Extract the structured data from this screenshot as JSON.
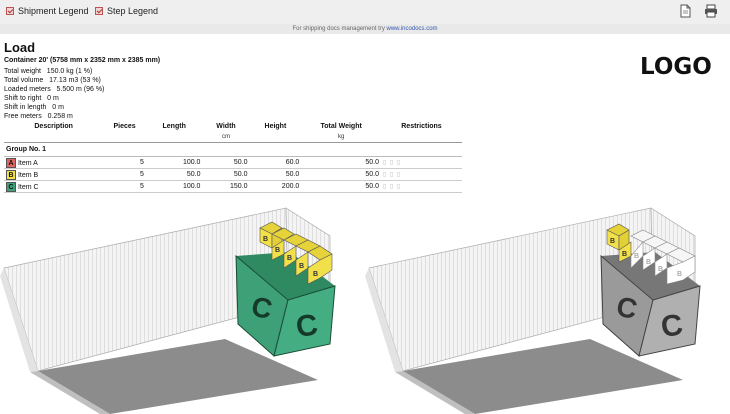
{
  "toolbar": {
    "shipment_legend": "Shipment Legend",
    "step_legend": "Step Legend",
    "icons": [
      "document-icon",
      "printer-icon"
    ]
  },
  "subbar": {
    "prefix": "For shipping docs management try",
    "link": "www.incodocs.com"
  },
  "header": {
    "title": "Load",
    "container": "Container 20' (5758 mm x 2352 mm x 2385 mm)",
    "logo": "LOGO"
  },
  "stats": [
    "Total weight   150.0 kg (1 %)",
    "Total volume   17.13 m3 (53 %)",
    "Loaded meters   5.500 m (96 %)",
    "Shift to right   0 m",
    "Shift in length   0 m",
    "Free meters   0.258 m"
  ],
  "table": {
    "headers": [
      "Description",
      "Pieces",
      "Length",
      "Width",
      "Height",
      "Total Weight",
      "Restrictions"
    ],
    "units": [
      "",
      "",
      "",
      "cm",
      "",
      "kg",
      ""
    ],
    "group": "Group No. 1",
    "rows": [
      {
        "badge": "A",
        "color": "#e06666",
        "name": "Item A",
        "pieces": "5",
        "length": "100.0",
        "width": "50.0",
        "height": "60.0",
        "weight": "50.0"
      },
      {
        "badge": "B",
        "color": "#f2e04a",
        "name": "Item B",
        "pieces": "5",
        "length": "50.0",
        "width": "50.0",
        "height": "50.0",
        "weight": "50.0"
      },
      {
        "badge": "C",
        "color": "#3fa07a",
        "name": "Item C",
        "pieces": "5",
        "length": "100.0",
        "width": "150.0",
        "height": "200.0",
        "weight": "50.0"
      }
    ]
  },
  "colors": {
    "item_a": "#e06666",
    "item_b": "#f2e04a",
    "item_c": "#3fa07a"
  }
}
